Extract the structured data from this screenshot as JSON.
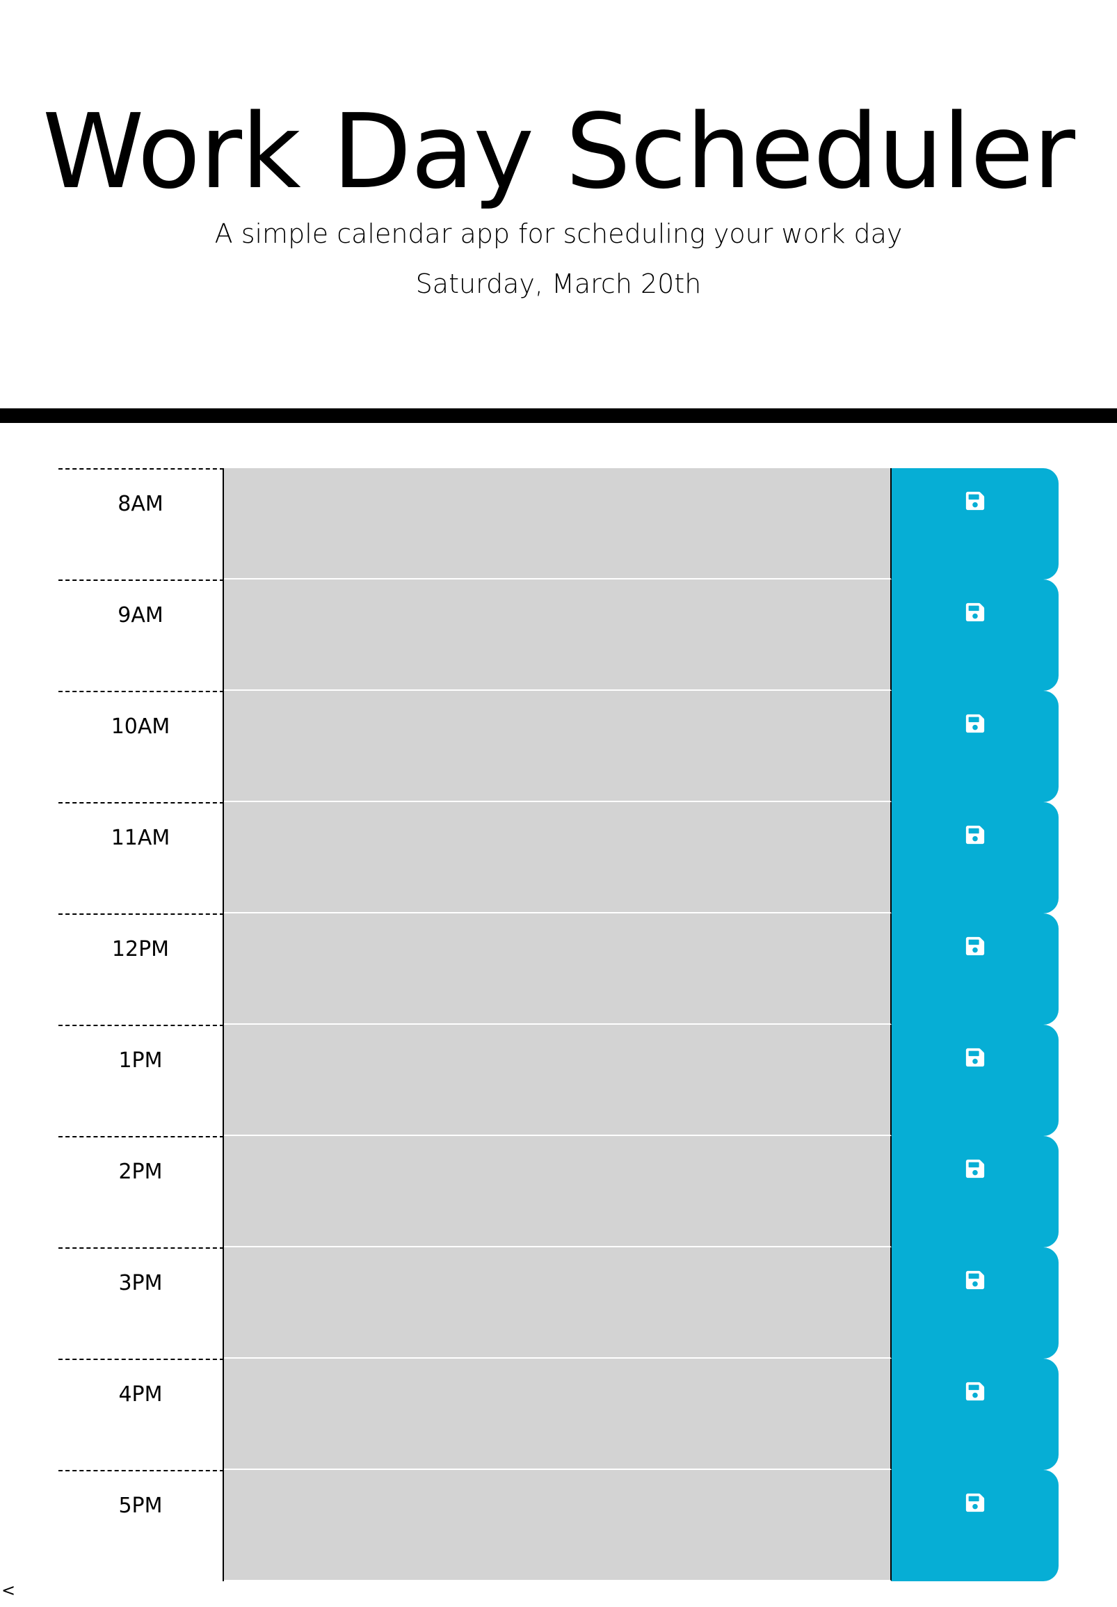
{
  "header": {
    "title": "Work Day Scheduler",
    "subtitle": "A simple calendar app for scheduling your work day",
    "current_day": "Saturday, March 20th"
  },
  "colors": {
    "save_button": "#06aed5",
    "time_block": "#d3d3d3",
    "divider": "#000000"
  },
  "time_blocks": [
    {
      "hour": "8AM",
      "description": "",
      "save_icon": "floppy-disk-icon"
    },
    {
      "hour": "9AM",
      "description": "",
      "save_icon": "floppy-disk-icon"
    },
    {
      "hour": "10AM",
      "description": "",
      "save_icon": "floppy-disk-icon"
    },
    {
      "hour": "11AM",
      "description": "",
      "save_icon": "floppy-disk-icon"
    },
    {
      "hour": "12PM",
      "description": "",
      "save_icon": "floppy-disk-icon"
    },
    {
      "hour": "1PM",
      "description": "",
      "save_icon": "floppy-disk-icon"
    },
    {
      "hour": "2PM",
      "description": "",
      "save_icon": "floppy-disk-icon"
    },
    {
      "hour": "3PM",
      "description": "",
      "save_icon": "floppy-disk-icon"
    },
    {
      "hour": "4PM",
      "description": "",
      "save_icon": "floppy-disk-icon"
    },
    {
      "hour": "5PM",
      "description": "",
      "save_icon": "floppy-disk-icon"
    }
  ],
  "footer": {
    "mark": "<"
  }
}
